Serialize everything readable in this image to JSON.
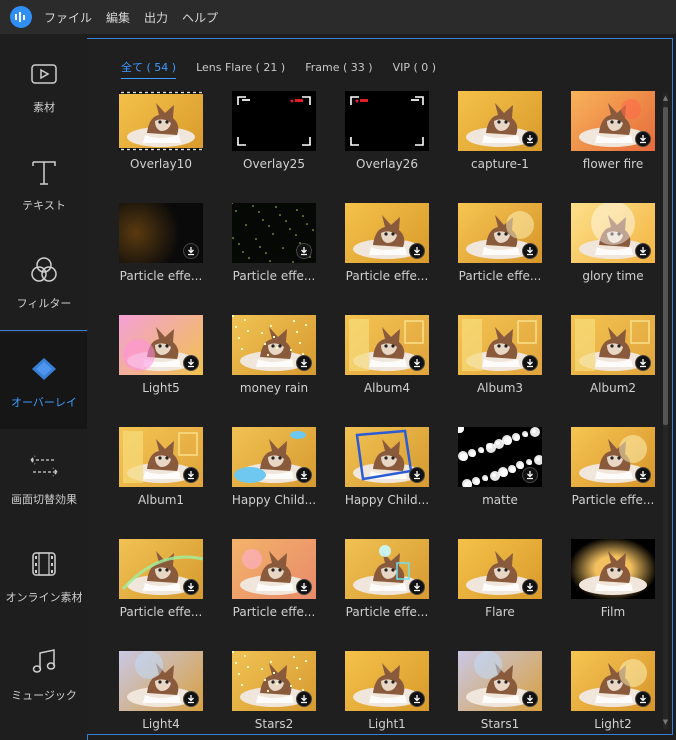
{
  "menu": {
    "items": [
      {
        "label": "ファイル"
      },
      {
        "label": "編集"
      },
      {
        "label": "出力"
      },
      {
        "label": "ヘルプ"
      }
    ]
  },
  "sidebar": {
    "items": [
      {
        "label": "素材",
        "icon": "media-icon"
      },
      {
        "label": "テキスト",
        "icon": "text-icon"
      },
      {
        "label": "フィルター",
        "icon": "filter-icon"
      },
      {
        "label": "オーバーレイ",
        "icon": "overlay-icon",
        "active": true
      },
      {
        "label": "画面切替効果",
        "icon": "transition-icon"
      },
      {
        "label": "オンライン素材",
        "icon": "film-icon"
      },
      {
        "label": "ミュージック",
        "icon": "music-icon"
      }
    ]
  },
  "tabs": [
    {
      "label": "全て ( 54 )",
      "active": true
    },
    {
      "label": "Lens Flare ( 21 )"
    },
    {
      "label": "Frame ( 33 )"
    },
    {
      "label": "VIP ( 0 )"
    }
  ],
  "grid": {
    "items": [
      {
        "label": "Overlay10",
        "style": "kitten-frame",
        "download": false
      },
      {
        "label": "Overlay25",
        "style": "black-rec",
        "download": false
      },
      {
        "label": "Overlay26",
        "style": "black-rec2",
        "download": false
      },
      {
        "label": "capture-1",
        "style": "kitten",
        "download": true
      },
      {
        "label": "flower fire",
        "style": "kitten-red",
        "download": true
      },
      {
        "label": "Particle effe...",
        "style": "dark-particle",
        "download": true
      },
      {
        "label": "Particle effe...",
        "style": "dark-stars",
        "download": true
      },
      {
        "label": "Particle effe...",
        "style": "kitten",
        "download": true
      },
      {
        "label": "Particle effe...",
        "style": "kitten-glow",
        "download": true
      },
      {
        "label": "glory time",
        "style": "kitten-bright",
        "download": true
      },
      {
        "label": "Light5",
        "style": "kitten-pink",
        "download": true
      },
      {
        "label": "money rain",
        "style": "kitten-gold",
        "download": true
      },
      {
        "label": "Album4",
        "style": "kitten-album",
        "download": true
      },
      {
        "label": "Album3",
        "style": "kitten-album",
        "download": true
      },
      {
        "label": "Album2",
        "style": "kitten-album",
        "download": true
      },
      {
        "label": "Album1",
        "style": "kitten-album",
        "download": true
      },
      {
        "label": "Happy Child...",
        "style": "kitten-cloud",
        "download": true
      },
      {
        "label": "Happy Child...",
        "style": "kitten-blueframe",
        "download": true
      },
      {
        "label": "matte",
        "style": "white-matte",
        "download": true
      },
      {
        "label": "Particle effe...",
        "style": "kitten-glow",
        "download": true
      },
      {
        "label": "Particle effe...",
        "style": "kitten-rainbow",
        "download": true
      },
      {
        "label": "Particle effe...",
        "style": "kitten-pinkglow",
        "download": true
      },
      {
        "label": "Particle effe...",
        "style": "kitten-cyan",
        "download": true
      },
      {
        "label": "Flare",
        "style": "kitten",
        "download": true
      },
      {
        "label": "Film",
        "style": "film",
        "download": false
      },
      {
        "label": "Light4",
        "style": "kitten-blue",
        "download": true
      },
      {
        "label": "Stars2",
        "style": "kitten-gold",
        "download": true
      },
      {
        "label": "Light1",
        "style": "kitten",
        "download": true
      },
      {
        "label": "Stars1",
        "style": "kitten-blue",
        "download": true
      },
      {
        "label": "Light2",
        "style": "kitten-glow",
        "download": true
      }
    ]
  },
  "colors": {
    "accent": "#3d9bff",
    "border": "#3a7fd6",
    "background": "#1e1e1e",
    "menubar": "#2b2b2b"
  }
}
